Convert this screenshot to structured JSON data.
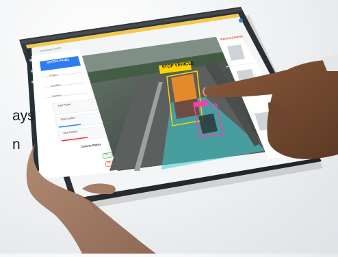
{
  "page": {
    "left_text_fragments": [
      "ays",
      "n"
    ]
  },
  "tablet": {
    "breadcrumb": "Dashboard / NRC",
    "sidebar": {
      "panel_button": "STATUS PANEL",
      "menu_items": [
        "Project",
        "Location",
        "Camera"
      ],
      "stats": [
        {
          "label": "Total Project"
        },
        {
          "label": "Total Location"
        },
        {
          "label": "Total Camera"
        }
      ],
      "camera_status_title": "Camera Status",
      "status_badges": [
        "On",
        "Off"
      ]
    },
    "video": {
      "alert_label": "STOP VEHICLE"
    },
    "recent_panel": {
      "title": "Recent Camera"
    }
  },
  "colors": {
    "tablet_frame": "#2b2d31",
    "sidebar_blue": "#2e7df0",
    "alert_yellow": "#ffd400",
    "road_overlay": "#39d0d6",
    "detection_pink": "#ff3ab2",
    "recent_title_red": "#e53935"
  }
}
